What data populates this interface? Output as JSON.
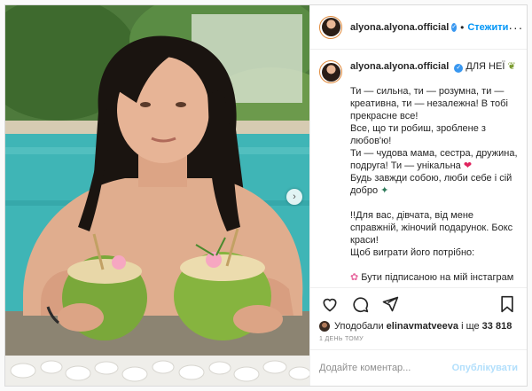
{
  "header": {
    "username": "alyona.alyona.official",
    "separator": "•",
    "follow_label": "Стежити",
    "more": "···"
  },
  "caption": {
    "username": "alyona.alyona.official",
    "intro": "ДЛЯ НЕЇ",
    "lines": [
      "Ти — сильна, ти — розумна, ти — креативна, ти — незалежна! В тобі прекрасне все!",
      "Все, що ти робиш, зроблене з любов'ю!",
      "Ти — чудова мама, сестра, дружина, подруга! Ти — унікальна",
      "Будь завжди собою, люби себе і сій добро",
      "",
      "!!Для вас, дівчата, від мене справжній, жіночий подарунок. Бокс краси!",
      "Щоб виграти його потрібно:",
      "",
      "Бути підписаною на мій інстаграм та телеграм-канал"
    ]
  },
  "likes": {
    "prefix": "Уподобали",
    "user": "elinavmatveeva",
    "suffix": "і ще",
    "count": "33 818"
  },
  "timestamp": "1 ДЕНЬ ТОМУ",
  "comment": {
    "placeholder": "Додайте коментар...",
    "post_label": "Опублікувати"
  },
  "colors": {
    "accent": "#0095f6",
    "verified": "#3897f0",
    "heart": "#e0245e"
  },
  "icons": [
    "verified-badge-icon",
    "more-options-icon",
    "carousel-next-icon",
    "heart-icon",
    "comment-icon",
    "share-icon",
    "bookmark-icon",
    "plant-emoji-icon",
    "red-heart-emoji-icon",
    "sparkle-emoji-icon",
    "flower-emoji-icon"
  ]
}
